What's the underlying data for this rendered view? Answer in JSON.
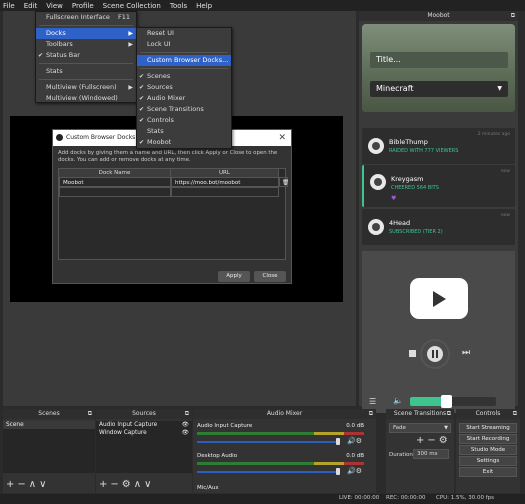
{
  "menubar": [
    "File",
    "Edit",
    "View",
    "Profile",
    "Scene Collection",
    "Tools",
    "Help"
  ],
  "view_menu": {
    "items": [
      {
        "label": "Fullscreen Interface",
        "shortcut": "F11"
      },
      {
        "label": "Docks",
        "submenu": true
      },
      {
        "label": "Toolbars",
        "submenu": true
      },
      {
        "label": "Status Bar",
        "checked": true
      },
      {
        "label": "Stats"
      },
      {
        "label": "Multiview (Fullscreen)",
        "submenu": true
      },
      {
        "label": "Multiview (Windowed)"
      }
    ]
  },
  "docks_menu": {
    "items": [
      {
        "label": "Reset UI"
      },
      {
        "label": "Lock UI"
      },
      {
        "label": "Custom Browser Docks..."
      },
      {
        "label": "Scenes",
        "checked": true
      },
      {
        "label": "Sources",
        "checked": true
      },
      {
        "label": "Audio Mixer",
        "checked": true
      },
      {
        "label": "Scene Transitions",
        "checked": true
      },
      {
        "label": "Controls",
        "checked": true
      },
      {
        "label": "Stats"
      },
      {
        "label": "Moobot",
        "checked": true
      }
    ]
  },
  "dialog": {
    "title": "Custom Browser Docks",
    "close": "✕",
    "description": "Add docks by giving them a name and URL, then click Apply or Close to open the docks. You can add or remove docks at any time.",
    "col_name": "Dock Name",
    "col_url": "URL",
    "rows": [
      {
        "name": "Moobot",
        "url": "https://moo.bot/moobot"
      }
    ],
    "apply": "Apply",
    "close_btn": "Close"
  },
  "moobot_dock": {
    "title": "Moobot",
    "stream_title": "Title...",
    "game": "Minecraft",
    "events": [
      {
        "user": "BibleThump",
        "detail": "RAIDED WITH 777 VIEWERS",
        "time": "2 minutes ago"
      },
      {
        "user": "Kreygasm",
        "detail": "CHEERED 564 BITS",
        "time": "now"
      },
      {
        "user": "4Head",
        "detail": "SUBSCRIBED (TIER 2)",
        "time": "now"
      }
    ],
    "volume": 0.42
  },
  "docks": {
    "scenes_title": "Scenes",
    "scenes": [
      "Scene"
    ],
    "sources_title": "Sources",
    "sources": [
      "Audio Input Capture",
      "Window Capture"
    ],
    "mixer_title": "Audio Mixer",
    "mixer": [
      {
        "name": "Audio Input Capture",
        "db": "0.0 dB"
      },
      {
        "name": "Desktop Audio",
        "db": "0.0 dB"
      },
      {
        "name": "Mic/Aux",
        "db": ""
      }
    ],
    "transitions_title": "Scene Transitions",
    "transition": "Fade",
    "duration_label": "Duration",
    "duration_value": "300 ms",
    "controls_title": "Controls",
    "controls": [
      "Start Streaming",
      "Start Recording",
      "Studio Mode",
      "Settings",
      "Exit"
    ]
  },
  "status": {
    "live": "LIVE: 00:00:00",
    "rec": "REC: 00:00:00",
    "cpu": "CPU: 1.5%, 30.00 fps"
  }
}
